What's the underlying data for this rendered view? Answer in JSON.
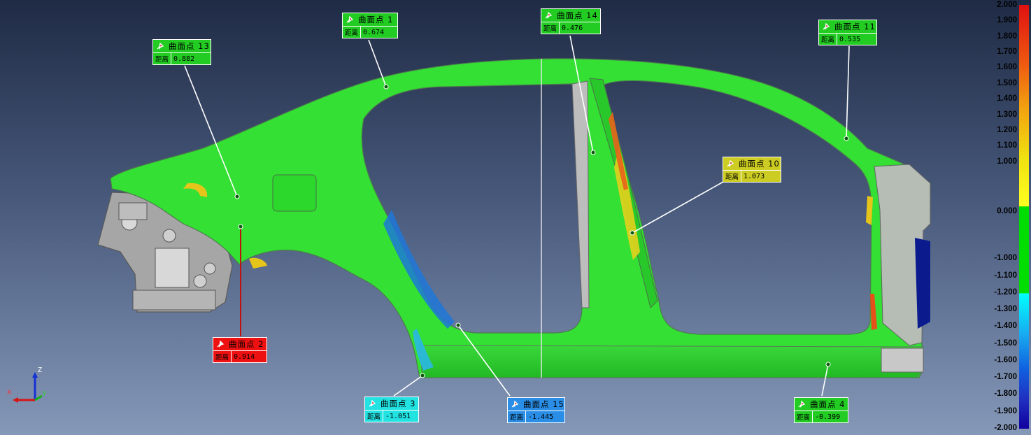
{
  "colors": {
    "surface": "#2bd82b",
    "zero_band": "#1ee61e",
    "warm": "#e8e01a",
    "hot": "#e4521a",
    "cold": "#1e76d6",
    "deep_cold": "#0a1a8a",
    "gray": "#9a9a9a"
  },
  "callouts": [
    {
      "id": "p13",
      "title": "曲面点 13",
      "dist_label": "距离",
      "value": "0.882",
      "bg": "#22cc22"
    },
    {
      "id": "p1",
      "title": "曲面点 1",
      "dist_label": "距离",
      "value": "0.674",
      "bg": "#22cc22"
    },
    {
      "id": "p14",
      "title": "曲面点 14",
      "dist_label": "距离",
      "value": "0.476",
      "bg": "#22cc22"
    },
    {
      "id": "p11",
      "title": "曲面点 11",
      "dist_label": "距离",
      "value": "0.535",
      "bg": "#22cc22"
    },
    {
      "id": "p10",
      "title": "曲面点 10",
      "dist_label": "距离",
      "value": "1.073",
      "bg": "#cccc22"
    },
    {
      "id": "p2",
      "title": "曲面点 2",
      "dist_label": "距离",
      "value": "0.914",
      "bg": "#ee1111"
    },
    {
      "id": "p3",
      "title": "曲面点 3",
      "dist_label": "距离",
      "value": "-1.051",
      "bg": "#22e2e2"
    },
    {
      "id": "p15",
      "title": "曲面点 15",
      "dist_label": "距离",
      "value": "-1.445",
      "bg": "#2a8ee6"
    },
    {
      "id": "p4",
      "title": "曲面点 4",
      "dist_label": "距离",
      "value": "-0.399",
      "bg": "#22cc22"
    }
  ],
  "scale": {
    "ticks": [
      "2.000",
      "1.900",
      "1.800",
      "1.700",
      "1.600",
      "1.500",
      "1.400",
      "1.300",
      "1.200",
      "1.100",
      "1.000",
      "0.000",
      "-1.000",
      "-1.100",
      "-1.200",
      "-1.300",
      "-1.400",
      "-1.500",
      "-1.600",
      "-1.700",
      "-1.800",
      "-1.900",
      "-2.000"
    ]
  },
  "triad": {
    "x": "X",
    "y": "Y",
    "z": "Z"
  }
}
